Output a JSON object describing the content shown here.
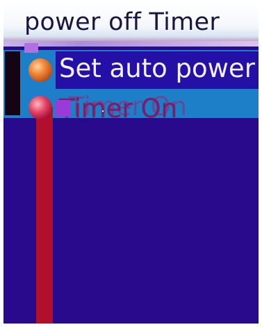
{
  "title_bar": {
    "title": "power off Timer"
  },
  "menu": {
    "items": [
      {
        "label": "Set auto power",
        "selected": true,
        "icon": "orange-radio-icon"
      },
      {
        "label": "Timer On",
        "selected": false,
        "icon": "red-radio-icon"
      }
    ]
  },
  "colors": {
    "background": "#2a0a8c",
    "menu_band": "#1c7fc8",
    "selection": "#2410a6",
    "accent_bar": "#b0102c"
  }
}
